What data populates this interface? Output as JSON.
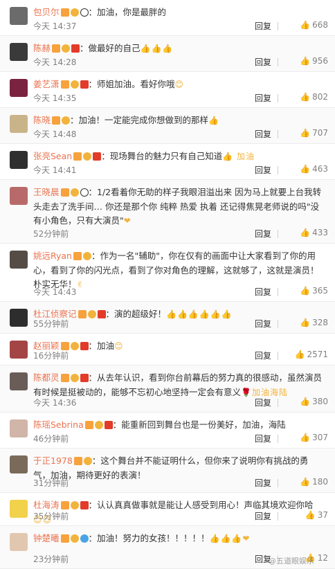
{
  "ui": {
    "reply_label": "回复",
    "like_icon": "thumb-up-icon"
  },
  "watermark": "@五道眼娱乐",
  "comments": [
    {
      "name": "包贝尔",
      "badges": [
        "v",
        "crown",
        "panda"
      ],
      "text": "：加油，你是最胖的",
      "emoji": "",
      "time": "今天 14:37",
      "likes": "668",
      "h": 52
    },
    {
      "name": "陈赫",
      "badges": [
        "v",
        "crown",
        "flag"
      ],
      "text": "：做最好的自己",
      "emoji": "👍👍👍",
      "time": "今天 14:28",
      "likes": "956",
      "h": 52
    },
    {
      "name": "姜艺潇",
      "badges": [
        "v",
        "crown",
        "flag"
      ],
      "text": "：师姐加油。看好你哦",
      "emoji": "😊",
      "time": "今天 14:35",
      "likes": "802",
      "h": 52
    },
    {
      "name": "陈晓",
      "badges": [
        "v",
        "crown"
      ],
      "text": "：加油！一定能完成你想做到的那样",
      "emoji": "👍",
      "time": "今天 14:48",
      "likes": "707",
      "h": 52
    },
    {
      "name": "张亮Sean",
      "badges": [
        "v",
        "crown",
        "flag"
      ],
      "text": "：现场舞台的魅力只有自己知道",
      "emoji": "👍 加油",
      "time": "今天 14:41",
      "likes": "463",
      "h": 52
    },
    {
      "name": "王晓晨",
      "badges": [
        "v",
        "crown",
        "panda"
      ],
      "text": "：1/2看着你无助的样子我眼泪溢出来 因为马上就要上台我转头走去了洗手间… 你还是那个你 纯粹 热爱 执着 还记得焦晃老师说的吗\"没有小角色，只有大演员\"",
      "emoji": "❤",
      "time": "52分钟前",
      "likes": "433",
      "h": 92
    },
    {
      "name": "姚远Ryan",
      "badges": [
        "v",
        "crown"
      ],
      "text": "：作为一名\"辅助\"，你在仅有的画面中让大家看到了你的用心，看到了你的闪光点，看到了你对角色的理解，这就够了，这就是演员！朴实无华！",
      "emoji": "✌",
      "time": "今天 14:43",
      "likes": "365",
      "h": 84
    },
    {
      "name": "杜江侦察记",
      "badges": [
        "v",
        "crown",
        "flag"
      ],
      "text": "：演的超级好！",
      "emoji": "👍👍👍👍👍👍",
      "time": "55分钟前",
      "likes": "328",
      "h": 46
    },
    {
      "name": "赵丽颖",
      "badges": [
        "v",
        "crown",
        "flag"
      ],
      "text": "：加油",
      "emoji": "😊",
      "time": "16分钟前",
      "likes": "2571",
      "h": 46
    },
    {
      "name": "陈都灵",
      "badges": [
        "v",
        "crown",
        "flag"
      ],
      "text": "：从去年认识，看到你台前幕后的努力真的很感动，虽然演员有时候是挺被动的，能够不忘初心地坚持一定会有意义",
      "emoji": "🌹加油海陆",
      "time": "今天 14:36",
      "likes": "380",
      "h": 68
    },
    {
      "name": "陈瑶Sebrina",
      "badges": [
        "v",
        "crown",
        "flag"
      ],
      "text": "：能重新回到舞台也是一份美好，加油，海陆",
      "emoji": "",
      "time": "46分钟前",
      "likes": "307",
      "h": 52
    },
    {
      "name": "于正1978",
      "badges": [
        "v",
        "crown"
      ],
      "text": "：这个舞台并不能证明什么，但你来了说明你有挑战的勇气，加油，期待更好的表演！",
      "emoji": "",
      "time": "31分钟前",
      "likes": "180",
      "h": 64
    },
    {
      "name": "杜海涛",
      "badges": [
        "v",
        "crown",
        "flag"
      ],
      "text": "：认认真真做事就是能让人感受到用心！声临其境欢迎你哈",
      "emoji": "😊😊",
      "time": "35分钟前",
      "likes": "37",
      "h": 48
    },
    {
      "name": "钟楚曦",
      "badges": [
        "v",
        "crown",
        "rainbow"
      ],
      "text": "：加油！努力的女孩！！！！！",
      "emoji": "👍👍👍❤",
      "time": "23分钟前",
      "likes": "12",
      "h": 62
    }
  ]
}
